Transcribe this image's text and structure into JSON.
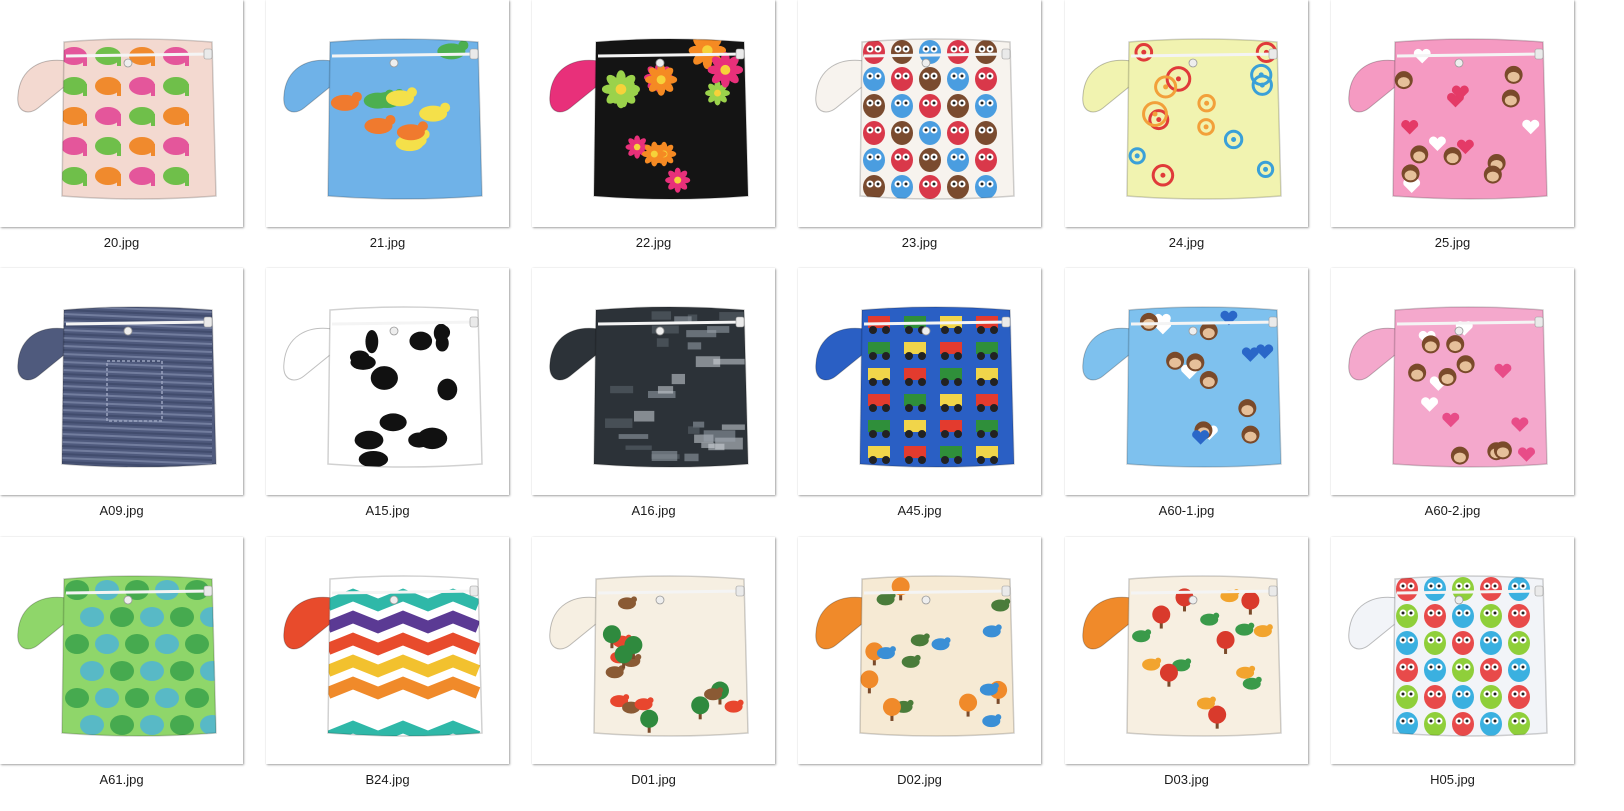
{
  "files": [
    {
      "name": "20.jpg",
      "base": "#f3d9d0",
      "motif": "#e4569b",
      "motif2": "#6fbf4a",
      "motif3": "#f08a2d",
      "strap": "#f3d9d0",
      "pattern": "elephants"
    },
    {
      "name": "21.jpg",
      "base": "#6fb2e8",
      "motif": "#f4e04a",
      "motif2": "#f07a2e",
      "motif3": "#4caf50",
      "strap": "#6fb2e8",
      "pattern": "dinos"
    },
    {
      "name": "22.jpg",
      "base": "#141414",
      "motif": "#f58a23",
      "motif2": "#e8307a",
      "motif3": "#9bd24b",
      "strap": "#e8307a",
      "pattern": "flowers"
    },
    {
      "name": "23.jpg",
      "base": "#f7f3ee",
      "motif": "#d9384a",
      "motif2": "#7a4b2f",
      "motif3": "#4a9de0",
      "strap": "#f7f3ee",
      "pattern": "owls"
    },
    {
      "name": "24.jpg",
      "base": "#f1f3b0",
      "motif": "#e03a3a",
      "motif2": "#3aa0d8",
      "motif3": "#f2a03a",
      "strap": "#f1f3b0",
      "pattern": "doodles"
    },
    {
      "name": "25.jpg",
      "base": "#f59ac2",
      "motif": "#7a4a2a",
      "motif2": "#e43a67",
      "motif3": "#ffffff",
      "strap": "#f59ac2",
      "pattern": "monkeys"
    },
    {
      "name": "A09.jpg",
      "base": "#4f5a7d",
      "motif": "#8a95b4",
      "motif2": "#3a4463",
      "motif3": "#9aa3bf",
      "strap": "#4f5a7d",
      "pattern": "denim"
    },
    {
      "name": "A15.jpg",
      "base": "#ffffff",
      "motif": "#111111",
      "motif2": "#111111",
      "motif3": "#111111",
      "strap": "#ffffff",
      "pattern": "cow"
    },
    {
      "name": "A16.jpg",
      "base": "#2c3238",
      "motif": "#9aa4ad",
      "motif2": "#5e6870",
      "motif3": "#cfd5da",
      "strap": "#2c3238",
      "pattern": "rock"
    },
    {
      "name": "A45.jpg",
      "base": "#2a5fc4",
      "motif": "#e33b2e",
      "motif2": "#2f8f3a",
      "motif3": "#f1d54a",
      "strap": "#2a5fc4",
      "pattern": "tractors"
    },
    {
      "name": "A60-1.jpg",
      "base": "#7ec1ee",
      "motif": "#7a4a2a",
      "motif2": "#2a67c8",
      "motif3": "#ffffff",
      "strap": "#7ec1ee",
      "pattern": "monkeys"
    },
    {
      "name": "A60-2.jpg",
      "base": "#f4a8cc",
      "motif": "#7a4a2a",
      "motif2": "#e84c88",
      "motif3": "#ffffff",
      "strap": "#f4a8cc",
      "pattern": "monkeys"
    },
    {
      "name": "A61.jpg",
      "base": "#8fd66a",
      "motif": "#4fb4d6",
      "motif2": "#c7ee7a",
      "motif3": "#3aa24a",
      "strap": "#8fd66a",
      "pattern": "turtles"
    },
    {
      "name": "B24.jpg",
      "base": "#ffffff",
      "motif": "#e84b2c",
      "motif2": "#5b3a94",
      "motif3": "#f2c12e",
      "strap": "#e84b2c",
      "pattern": "chevron"
    },
    {
      "name": "D01.jpg",
      "base": "#f6efe2",
      "motif": "#2f8a3e",
      "motif2": "#8a5a34",
      "motif3": "#e8462e",
      "strap": "#f6efe2",
      "pattern": "woodland"
    },
    {
      "name": "D02.jpg",
      "base": "#f6ead4",
      "motif": "#f08a2a",
      "motif2": "#4a7c3a",
      "motif3": "#3a8fd6",
      "strap": "#f08a2a",
      "pattern": "woodland"
    },
    {
      "name": "D03.jpg",
      "base": "#f7efe1",
      "motif": "#d93a2c",
      "motif2": "#3a9a4a",
      "motif3": "#f2a42e",
      "strap": "#f08a2a",
      "pattern": "birds"
    },
    {
      "name": "H05.jpg",
      "base": "#f2f4f8",
      "motif": "#e84a4a",
      "motif2": "#3ab0e0",
      "motif3": "#8fcf3a",
      "strap": "#f2f4f8",
      "pattern": "owls"
    }
  ]
}
